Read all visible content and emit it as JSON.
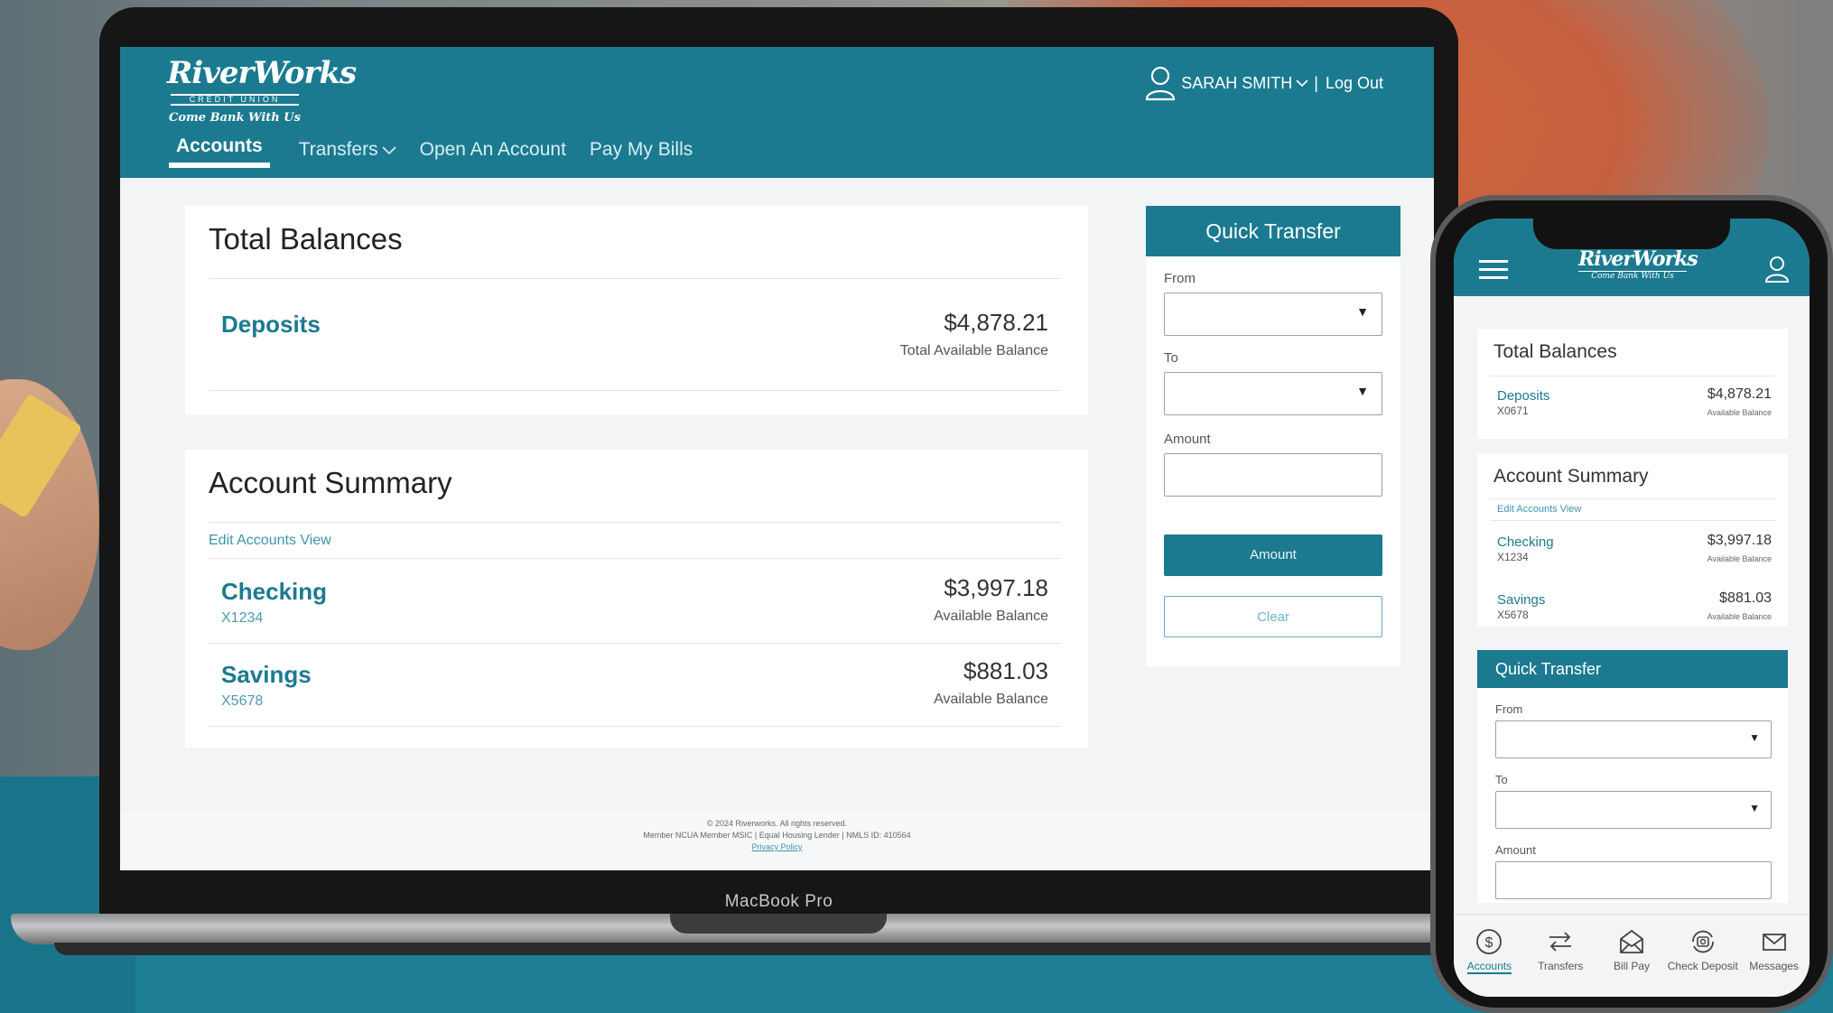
{
  "laptop": {
    "device_label": "MacBook Pro"
  },
  "brand": {
    "name": "RiverWorks",
    "sub": "CREDIT UNION",
    "tagline": "Come Bank With Us",
    "primary_color": "#1b7a90"
  },
  "header": {
    "user_name": "SARAH SMITH",
    "separator": "|",
    "logout_label": "Log Out"
  },
  "nav": {
    "items": [
      {
        "label": "Accounts",
        "active": true
      },
      {
        "label": "Transfers",
        "dropdown": true
      },
      {
        "label": "Open An Account"
      },
      {
        "label": "Pay My Bills"
      }
    ]
  },
  "total_balances": {
    "title": "Total Balances",
    "deposits_label": "Deposits",
    "deposits_amount": "$4,878.21",
    "deposits_caption": "Total Available Balance"
  },
  "account_summary": {
    "title": "Account Summary",
    "edit_label": "Edit Accounts View",
    "accounts": [
      {
        "name": "Checking",
        "number": "X1234",
        "amount": "$3,997.18",
        "caption": "Available Balance"
      },
      {
        "name": "Savings",
        "number": "X5678",
        "amount": "$881.03",
        "caption": "Available Balance"
      }
    ]
  },
  "quick_transfer": {
    "title": "Quick Transfer",
    "from_label": "From",
    "to_label": "To",
    "amount_label": "Amount",
    "submit_label": "Amount",
    "clear_label": "Clear"
  },
  "footer": {
    "line1": "© 2024 Riverworks. All rights reserved.",
    "line2": "Member NCUA Member MSIC | Equal Housing Lender | NMLS ID: 410564",
    "privacy": "Privacy Policy"
  },
  "phone": {
    "total_title": "Total Balances",
    "deposits_label": "Deposits",
    "deposits_number": "X0671",
    "deposits_amount": "$4,878.21",
    "deposits_caption": "Available Balance",
    "summary_title": "Account Summary",
    "edit_label": "Edit Accounts View",
    "accounts": [
      {
        "name": "Checking",
        "number": "X1234",
        "amount": "$3,997.18",
        "caption": "Available Balance"
      },
      {
        "name": "Savings",
        "number": "X5678",
        "amount": "$881.03",
        "caption": "Available Balance"
      }
    ],
    "qt_title": "Quick Transfer",
    "from_label": "From",
    "to_label": "To",
    "amount_label": "Amount",
    "tabs": [
      {
        "label": "Accounts",
        "icon": "dollar-circle-icon",
        "active": true
      },
      {
        "label": "Transfers",
        "icon": "transfer-arrows-icon"
      },
      {
        "label": "Bill Pay",
        "icon": "envelope-open-icon"
      },
      {
        "label": "Check Deposit",
        "icon": "camera-rotate-icon"
      },
      {
        "label": "Messages",
        "icon": "mail-icon"
      }
    ]
  }
}
